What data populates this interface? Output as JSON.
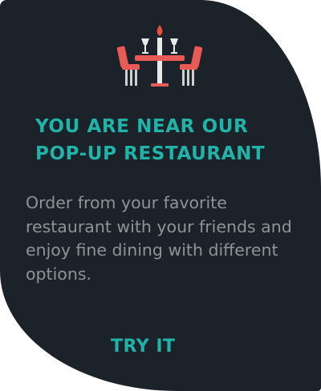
{
  "promo": {
    "icon": "dinner-table-icon",
    "headline_line1": "YOU ARE NEAR OUR",
    "headline_line2": "POP-UP RESTAURANT",
    "body": "Order from your favorite restaurant with your friends and enjoy fine dining with different options.",
    "cta_label": "TRY IT"
  },
  "colors": {
    "background": "#1b2229",
    "accent": "#21b3a8",
    "body_text": "#8c949a",
    "chair": "#e85a56",
    "flame": "#e8503c",
    "glass": "#e9e9e9"
  }
}
